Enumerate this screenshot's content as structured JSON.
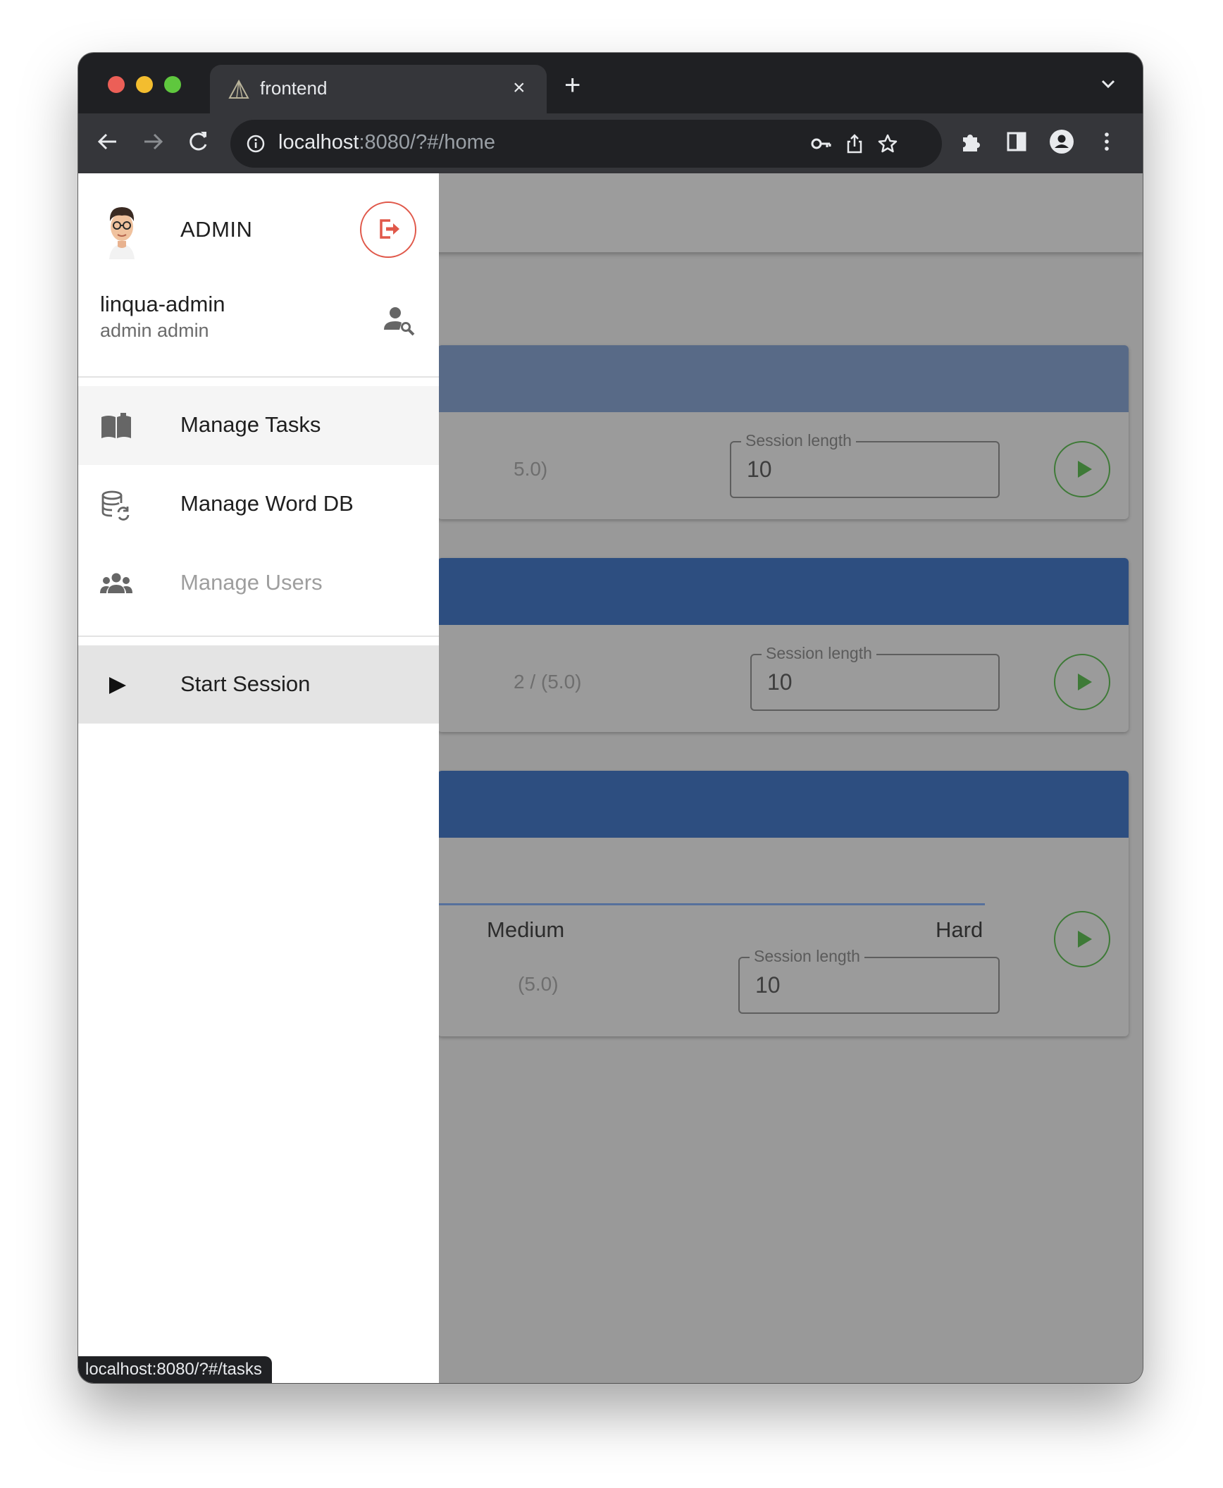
{
  "browser": {
    "tab_title": "frontend",
    "tab_close": "×",
    "new_tab": "+",
    "url_host": "localhost",
    "url_rest": ":8080/?#/home",
    "status_url": "localhost:8080/?#/tasks"
  },
  "drawer": {
    "role": "ADMIN",
    "username": "linqua-admin",
    "full_name": "admin admin",
    "menu": [
      {
        "label": "Manage Tasks",
        "icon": "book-icon",
        "state": "hovered"
      },
      {
        "label": "Manage Word DB",
        "icon": "database-sync-icon",
        "state": "normal"
      },
      {
        "label": "Manage Users",
        "icon": "users-icon",
        "state": "disabled"
      }
    ],
    "start_session": {
      "label": "Start Session",
      "icon": "play-icon",
      "state": "active"
    }
  },
  "cards": [
    {
      "header_color": "#586a87",
      "partial_text": "5.0)",
      "session_label": "Session length",
      "session_value": "10"
    },
    {
      "header_color": "#2d4e80",
      "partial_text": "2 / (5.0)",
      "session_label": "Session length",
      "session_value": "10"
    },
    {
      "header_color": "#2d4e80",
      "slider_labels": [
        "Medium",
        "Hard"
      ],
      "partial_text": "(5.0)",
      "session_label": "Session length",
      "session_value": "10"
    }
  ],
  "colors": {
    "accent_play": "#3e7a37",
    "logout": "#e0584a"
  }
}
